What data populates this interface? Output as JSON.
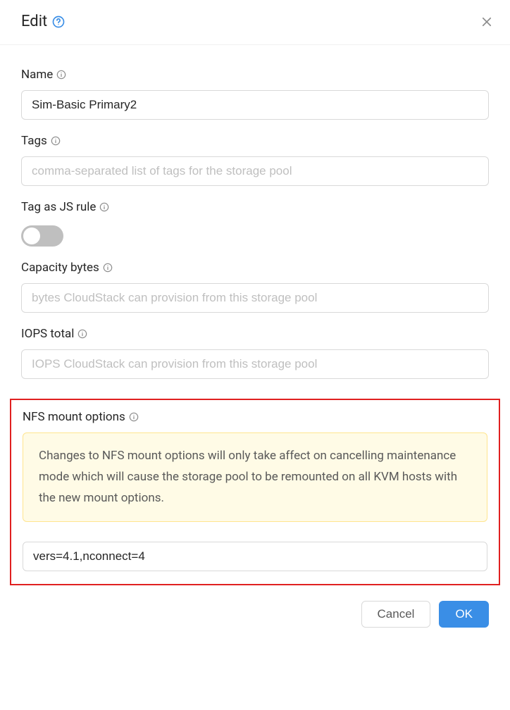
{
  "header": {
    "title": "Edit"
  },
  "fields": {
    "name": {
      "label": "Name",
      "value": "Sim-Basic Primary2"
    },
    "tags": {
      "label": "Tags",
      "placeholder": "comma-separated list of tags for the storage pool",
      "value": ""
    },
    "tag_js_rule": {
      "label": "Tag as JS rule",
      "on": false
    },
    "capacity_bytes": {
      "label": "Capacity bytes",
      "placeholder": "bytes CloudStack can provision from this storage pool",
      "value": ""
    },
    "iops_total": {
      "label": "IOPS total",
      "placeholder": "IOPS CloudStack can provision from this storage pool",
      "value": ""
    },
    "nfs_mount": {
      "label": "NFS mount options",
      "warning": "Changes to NFS mount options will only take affect on cancelling maintenance mode which will cause the storage pool to be remounted on all KVM hosts with the new mount options.",
      "value": "vers=4.1,nconnect=4"
    }
  },
  "footer": {
    "cancel_label": "Cancel",
    "ok_label": "OK"
  }
}
